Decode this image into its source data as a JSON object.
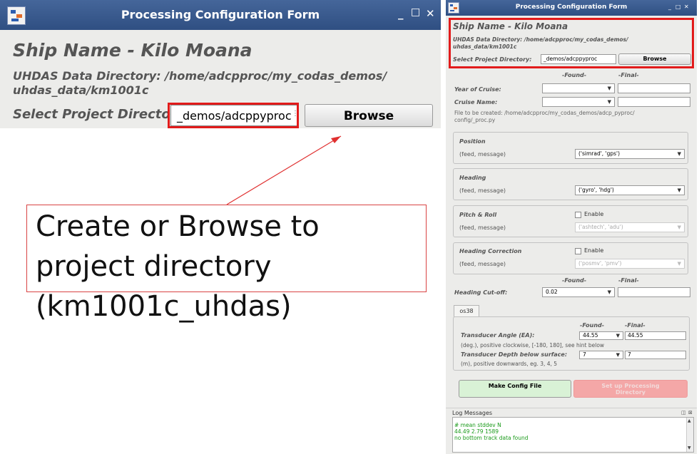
{
  "window": {
    "title": "Processing Configuration Form",
    "minimize": "_",
    "maximize": "□",
    "close": "✕"
  },
  "header": {
    "ship_name": "Ship Name - Kilo Moana",
    "data_directory": "UHDAS Data Directory: /home/adcpproc/my_codas_demos/ uhdas_data/km1001c",
    "select_label": "Select Project Directory:",
    "project_value": "_demos/adcppyproc",
    "browse_label": "Browse"
  },
  "callout": {
    "text": "Create or Browse to project directory (km1001c_uhdas)"
  },
  "form": {
    "found_header": "-Found-",
    "final_header": "-Final-",
    "year_label": "Year of Cruise:",
    "cruise_label": "Cruise Name:",
    "file_note": "File to be created: /home/adcpproc/my_codas_demos/adcp_pyproc/ config/_proc.py",
    "position": {
      "title": "Position",
      "sub": "(feed, message)",
      "value": "('simrad', 'gps')"
    },
    "heading": {
      "title": "Heading",
      "sub": "(feed, message)",
      "value": "('gyro', 'hdg')"
    },
    "pitch": {
      "title": "Pitch & Roll",
      "sub": "(feed, message)",
      "enable": "Enable",
      "value": "('ashtech', 'adu')"
    },
    "hcorr": {
      "title": "Heading Correction",
      "sub": "(feed, message)",
      "enable": "Enable",
      "value": "('posmv', 'pmv')"
    },
    "cutoff_label": "Heading Cut-off:",
    "cutoff_value": "0.02",
    "tab": "os38",
    "tx_angle_label": "Transducer Angle (EA):",
    "tx_angle_found": "44.55",
    "tx_angle_final": "44.55",
    "tx_angle_hint": "(deg.), positive clockwise, [-180, 180], see hint below",
    "tx_depth_label": "Transducer Depth below surface:",
    "tx_depth_found": "7",
    "tx_depth_final": "7",
    "tx_depth_hint": "(m), positive downwards, eg. 3, 4, 5",
    "make_config": "Make Config File",
    "setup": "Set up Processing Directory"
  },
  "log": {
    "title": "Log Messages",
    "lines": [
      "# mean   stddev  N",
      "44.49   2.79  1589",
      "no bottom track data found"
    ]
  },
  "colors": {
    "highlight": "#e21b1b",
    "titlebar": "#3a5a8c",
    "log_text": "#1a9a1a"
  }
}
